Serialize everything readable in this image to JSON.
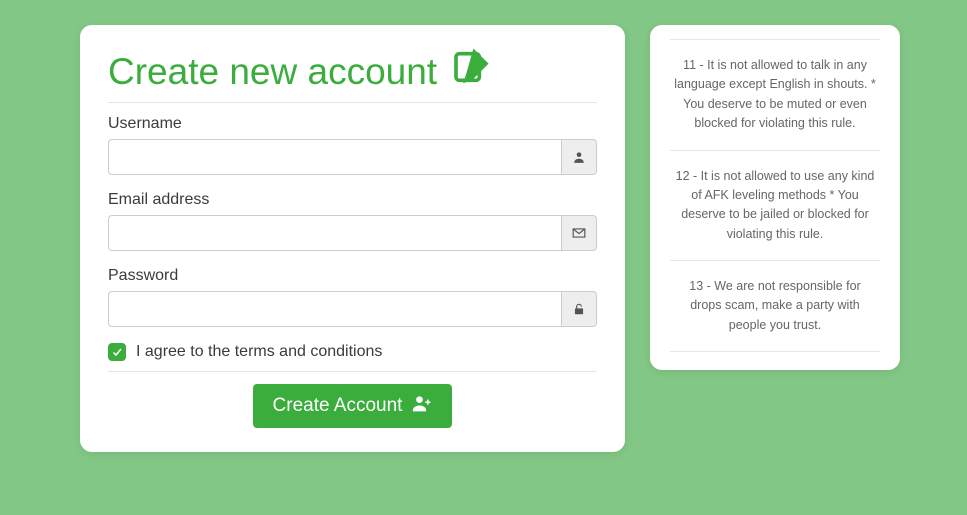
{
  "main": {
    "title": "Create new account",
    "username_label": "Username",
    "email_label": "Email address",
    "password_label": "Password",
    "terms_label": "I agree to the terms and conditions",
    "submit_label": "Create Account",
    "username_value": "",
    "email_value": "",
    "password_value": ""
  },
  "rules": [
    "11 - It is not allowed to talk in any language except English in shouts. * You deserve to be muted or even blocked for violating this rule.",
    "12 - It is not allowed to use any kind of AFK leveling methods * You deserve to be jailed or blocked for violating this rule.",
    "13 - We are not responsible for drops scam, make a party with people you trust."
  ],
  "colors": {
    "primary": "#3aad3d",
    "bg": "#82c785"
  }
}
